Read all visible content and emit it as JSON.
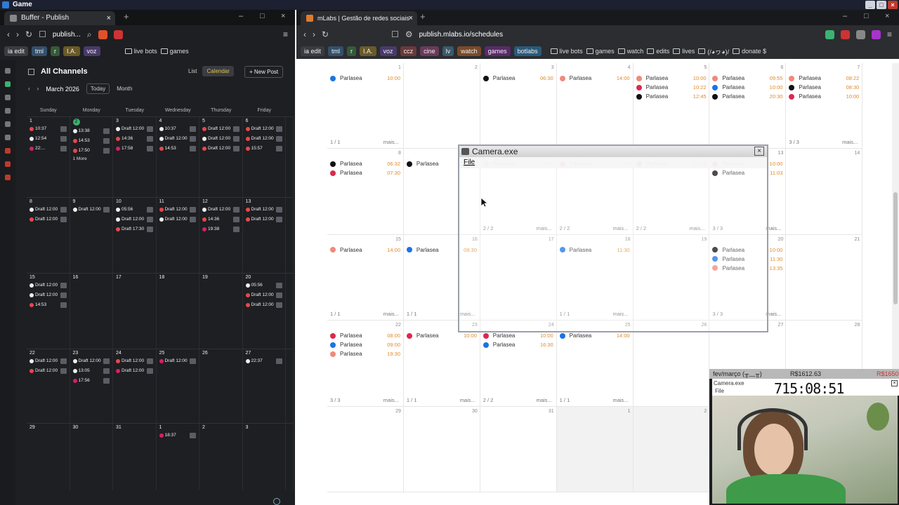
{
  "os": {
    "title": "Game"
  },
  "left": {
    "tab": "Buffer - Publish",
    "url": "publish...",
    "bookmarks": [
      "ia edit",
      "tml",
      "r",
      "I.A.",
      "voz"
    ],
    "folders": [
      "live bots",
      "games"
    ],
    "header": {
      "title": "All Channels",
      "list": "List",
      "calendar": "Calendar",
      "new_post": "New Post",
      "month": "March 2026",
      "today": "Today",
      "view": "Month"
    },
    "days": [
      "Sunday",
      "Monday",
      "Tuesday",
      "Wednesday",
      "Thursday",
      "Friday"
    ],
    "weeks": [
      [
        {
          "n": "1",
          "ev": [
            [
              "r",
              "10:37"
            ],
            [
              "w",
              "12:54"
            ],
            [
              "p",
              "22:..."
            ]
          ]
        },
        {
          "n": "2",
          "sel": true,
          "ev": [
            [
              "w",
              "13:38"
            ],
            [
              "r",
              "14:53"
            ],
            [
              "r",
              "17:50"
            ]
          ],
          "more": "1 More"
        },
        {
          "n": "3",
          "ev": [
            [
              "w",
              "Draft 12:00"
            ],
            [
              "r",
              "14:36"
            ],
            [
              "p",
              "17:58"
            ]
          ]
        },
        {
          "n": "4",
          "ev": [
            [
              "w",
              "10:37"
            ],
            [
              "w",
              "Draft 12:00"
            ],
            [
              "r",
              "14:53"
            ]
          ]
        },
        {
          "n": "5",
          "ev": [
            [
              "r",
              "Draft 12:00"
            ],
            [
              "w",
              "Draft 12:00"
            ],
            [
              "r",
              "Draft 12:00"
            ]
          ]
        },
        {
          "n": "6",
          "ev": [
            [
              "r",
              "Draft 12:00"
            ],
            [
              "r",
              "Draft 12:00"
            ],
            [
              "r",
              "15:57"
            ]
          ]
        }
      ],
      [
        {
          "n": "8",
          "ev": [
            [
              "w",
              "Draft 12:00"
            ],
            [
              "r",
              "Draft 12:00"
            ]
          ]
        },
        {
          "n": "9",
          "ev": [
            [
              "w",
              "Draft 12:00"
            ]
          ]
        },
        {
          "n": "10",
          "ev": [
            [
              "w",
              "05:56"
            ],
            [
              "w",
              "Draft 12:00"
            ],
            [
              "r",
              "Draft 17:30"
            ]
          ]
        },
        {
          "n": "11",
          "ev": [
            [
              "r",
              "Draft 12:00"
            ],
            [
              "w",
              "Draft 12:00"
            ]
          ]
        },
        {
          "n": "12",
          "ev": [
            [
              "w",
              "Draft 12:00"
            ],
            [
              "r",
              "14:36"
            ],
            [
              "p",
              "19:38"
            ]
          ]
        },
        {
          "n": "13",
          "ev": [
            [
              "r",
              "Draft 12:00"
            ],
            [
              "r",
              "Draft 12:00"
            ]
          ]
        }
      ],
      [
        {
          "n": "15",
          "ev": [
            [
              "w",
              "Draft 12:00"
            ],
            [
              "w",
              "Draft 12:00"
            ],
            [
              "r",
              "14:53"
            ]
          ]
        },
        {
          "n": "16",
          "ev": []
        },
        {
          "n": "17",
          "ev": []
        },
        {
          "n": "18",
          "ev": []
        },
        {
          "n": "19",
          "ev": []
        },
        {
          "n": "20",
          "ev": [
            [
              "w",
              "05:56"
            ],
            [
              "r",
              "Draft 12:00"
            ],
            [
              "r",
              "Draft 12:00"
            ]
          ]
        }
      ],
      [
        {
          "n": "22",
          "ev": [
            [
              "w",
              "Draft 12:00"
            ],
            [
              "r",
              "Draft 12:00"
            ]
          ]
        },
        {
          "n": "23",
          "ev": [
            [
              "w",
              "Draft 12:00"
            ],
            [
              "w",
              "13:05"
            ],
            [
              "p",
              "17:56"
            ]
          ]
        },
        {
          "n": "24",
          "ev": [
            [
              "r",
              "Draft 12:00"
            ],
            [
              "p",
              "Draft 12:00"
            ]
          ]
        },
        {
          "n": "25",
          "ev": [
            [
              "p",
              "Draft 12:00"
            ]
          ]
        },
        {
          "n": "26",
          "ev": []
        },
        {
          "n": "27",
          "ev": [
            [
              "w",
              "22:37"
            ]
          ]
        }
      ],
      [
        {
          "n": "29",
          "ev": []
        },
        {
          "n": "30",
          "ev": []
        },
        {
          "n": "31",
          "ev": []
        },
        {
          "n": "1",
          "ev": [
            [
              "p",
              "18:37"
            ]
          ]
        },
        {
          "n": "2",
          "ev": []
        },
        {
          "n": "3",
          "ev": []
        }
      ]
    ]
  },
  "right": {
    "tab": "mLabs | Gestão de redes sociais",
    "url": "publish.mlabs.io/schedules",
    "bookmarks": [
      "ia edit",
      "tml",
      "r",
      "I.A.",
      "voz",
      "ccz",
      "cine",
      "lv",
      "watch",
      "games",
      "botlabs"
    ],
    "folders": [
      "live bots",
      "games",
      "watch",
      "edits",
      "lives",
      "(/◕ヮ◕)/",
      "donate $"
    ],
    "weeks": [
      [
        {
          "n": "1",
          "ev": [
            [
              "b",
              "10:00"
            ]
          ],
          "foot": [
            "1 / 1",
            "mais..."
          ]
        },
        {
          "n": "2",
          "ev": []
        },
        {
          "n": "3",
          "ev": [
            [
              "k",
              "06:30"
            ]
          ]
        },
        {
          "n": "4",
          "ev": [
            [
              "i",
              "14:00"
            ]
          ]
        },
        {
          "n": "5",
          "ev": [
            [
              "i",
              "10:00"
            ],
            [
              "r",
              "10:22"
            ],
            [
              "k",
              "12:45"
            ]
          ]
        },
        {
          "n": "6",
          "ev": [
            [
              "i",
              "09:55"
            ],
            [
              "b",
              "10:00"
            ],
            [
              "k",
              "20:30"
            ]
          ]
        },
        {
          "n": "7",
          "ev": [
            [
              "i",
              "08:22"
            ],
            [
              "k",
              "08:30"
            ],
            [
              "r",
              "10:00"
            ]
          ],
          "foot": [
            "3 / 3",
            "mais..."
          ]
        }
      ],
      [
        {
          "n": "8",
          "ev": [
            [
              "k",
              "06:32"
            ],
            [
              "r",
              "07:30"
            ]
          ]
        },
        {
          "n": "9",
          "ev": [
            [
              "k",
              ""
            ]
          ]
        },
        {
          "n": "10",
          "ev": [
            [
              "i",
              "14:50"
            ]
          ],
          "foot": [
            "2 / 2",
            "mais..."
          ]
        },
        {
          "n": "11",
          "ev": [
            [
              "r",
              "10:00"
            ]
          ],
          "foot": [
            "2 / 2",
            "mais..."
          ]
        },
        {
          "n": "12",
          "ev": [
            [
              "b",
              "18:55"
            ]
          ],
          "foot": [
            "2 / 2",
            "mais..."
          ]
        },
        {
          "n": "13",
          "ev": [
            [
              "r",
              "10:00"
            ],
            [
              "k",
              "11:03"
            ]
          ],
          "foot": [
            "3 / 3",
            "mais..."
          ]
        },
        {
          "n": "14",
          "ev": []
        }
      ],
      [
        {
          "n": "15",
          "ev": [
            [
              "i",
              "14:00"
            ]
          ],
          "foot": [
            "1 / 1",
            "mais..."
          ]
        },
        {
          "n": "16",
          "ev": [
            [
              "b",
              "08:30"
            ]
          ],
          "foot": [
            "1 / 1",
            "mais..."
          ]
        },
        {
          "n": "17",
          "ev": []
        },
        {
          "n": "18",
          "ev": [
            [
              "b",
              "11:30"
            ]
          ],
          "foot": [
            "1 / 1",
            "mais..."
          ]
        },
        {
          "n": "19",
          "ev": []
        },
        {
          "n": "20",
          "ev": [
            [
              "k",
              "10:00"
            ],
            [
              "b",
              "11:30"
            ],
            [
              "i",
              "13:35"
            ]
          ],
          "foot": [
            "3 / 3",
            "mais..."
          ]
        },
        {
          "n": "21",
          "ev": []
        }
      ],
      [
        {
          "n": "22",
          "ev": [
            [
              "r",
              "08:00"
            ],
            [
              "b",
              "09:00"
            ],
            [
              "i",
              "19:30"
            ]
          ],
          "foot": [
            "3 / 3",
            "mais..."
          ]
        },
        {
          "n": "23",
          "ev": [
            [
              "r",
              "10:00"
            ]
          ],
          "foot": [
            "1 / 1",
            "mais..."
          ]
        },
        {
          "n": "24",
          "ev": [
            [
              "r",
              "10:00"
            ],
            [
              "b",
              "16:30"
            ]
          ],
          "foot": [
            "2 / 2",
            "mais..."
          ]
        },
        {
          "n": "25",
          "ev": [
            [
              "b",
              "14:00"
            ]
          ],
          "foot": [
            "1 / 1",
            "mais..."
          ]
        },
        {
          "n": "26",
          "ev": []
        },
        {
          "n": "27",
          "ev": []
        },
        {
          "n": "28",
          "ev": []
        }
      ],
      [
        {
          "n": "29",
          "ev": []
        },
        {
          "n": "30",
          "ev": []
        },
        {
          "n": "31",
          "ev": []
        },
        {
          "n": "1",
          "gray": true,
          "ev": []
        },
        {
          "n": "2",
          "gray": true,
          "ev": []
        },
        {
          "n": "",
          "ev": []
        },
        {
          "n": "",
          "ev": []
        }
      ]
    ],
    "event_name": "Parlasea"
  },
  "camera": {
    "title": "Camera.exe",
    "menu": "File"
  },
  "webcam": {
    "header": "fev/março (╥﹏╥)",
    "money": "R$1612.63",
    "money2": "R$1650",
    "sub": "Camera.exe",
    "clock": "715:08:51",
    "file": "File"
  },
  "colors": {
    "buffer_green": "#3cb371",
    "mlabs_orange": "#e08a2c"
  }
}
